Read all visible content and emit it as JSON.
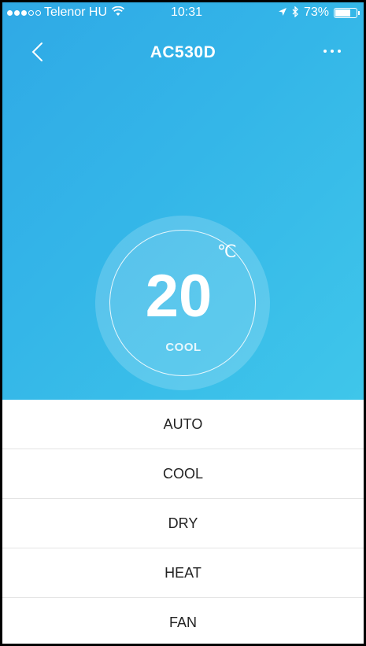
{
  "status_bar": {
    "carrier": "Telenor HU",
    "time": "10:31",
    "battery": "73%",
    "battery_level": 0.73,
    "signal_dots_filled": 3,
    "signal_dots_total": 5
  },
  "nav": {
    "title": "AC530D"
  },
  "thermostat": {
    "temperature": "20",
    "unit": "℃",
    "mode": "COOL"
  },
  "mode_options": [
    "AUTO",
    "COOL",
    "DRY",
    "HEAT",
    "FAN"
  ],
  "colors": {
    "gradient_start": "#2fa9e6",
    "gradient_end": "#3fc6ea",
    "text_dark": "#222222",
    "divider": "#e4e4e4"
  }
}
